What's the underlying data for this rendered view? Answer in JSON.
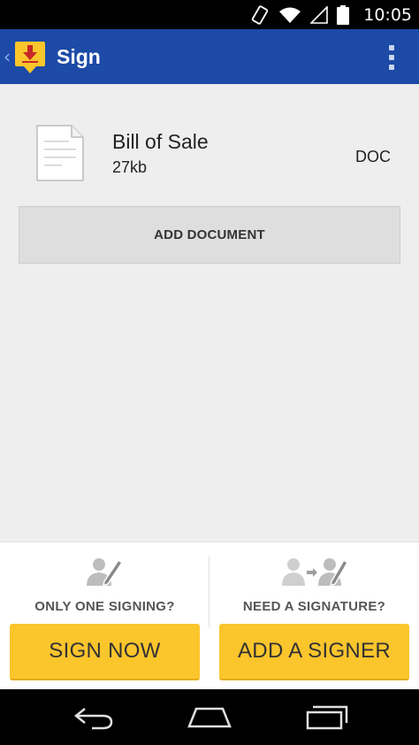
{
  "status_bar": {
    "time": "10:05",
    "icons": [
      "vibrate-icon",
      "wifi-icon",
      "signal-icon",
      "battery-icon"
    ]
  },
  "action_bar": {
    "title": "Sign",
    "up_icon": "chevron-left-icon",
    "app_icon": "download-doc-icon",
    "overflow_icon": "overflow-menu-icon"
  },
  "document": {
    "name": "Bill of Sale",
    "size": "27kb",
    "type": "DOC"
  },
  "add_document_label": "ADD DOCUMENT",
  "bottom_panel": {
    "left": {
      "prompt": "ONLY ONE SIGNING?",
      "button_label": "SIGN NOW",
      "icon": "person-pen-icon"
    },
    "right": {
      "prompt": "NEED A SIGNATURE?",
      "button_label": "ADD A SIGNER",
      "icon": "person-to-person-pen-icon"
    }
  },
  "nav_bar": {
    "icons": [
      "back-icon",
      "home-icon",
      "recents-icon"
    ]
  },
  "colors": {
    "action_bar": "#1c4aa6",
    "accent_yellow": "#fbc52c",
    "content_bg": "#eeeeee"
  }
}
